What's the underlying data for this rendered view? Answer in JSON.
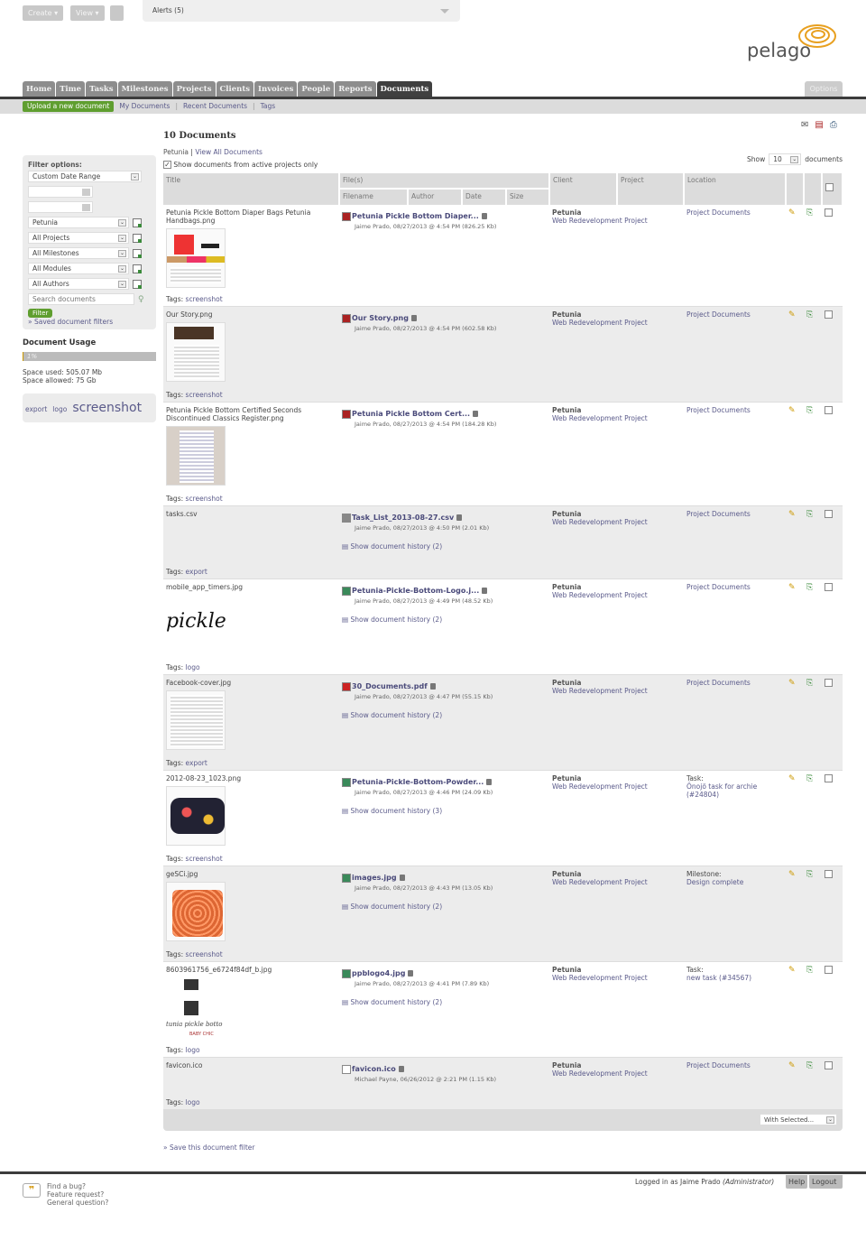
{
  "topbar": {
    "create": "Create ▾",
    "view": "View ▾",
    "alerts": "Alerts (5)"
  },
  "brand": {
    "name": "pelago",
    "accent": "#e8a020"
  },
  "nav": {
    "tabs": [
      "Home",
      "Time",
      "Tasks",
      "Milestones",
      "Projects",
      "Clients",
      "Invoices",
      "People",
      "Reports",
      "Documents"
    ],
    "active": "Documents",
    "options": "Options"
  },
  "subnav": {
    "upload": "Upload a new document",
    "links": [
      "My Documents",
      "Recent Documents",
      "Tags"
    ]
  },
  "filters": {
    "heading": "Filter options:",
    "date_range": "Custom Date Range",
    "client": "Petunia",
    "project": "All Projects",
    "milestone": "All Milestones",
    "module": "All Modules",
    "author": "All Authors",
    "search_placeholder": "Search documents",
    "filter_button": "Filter",
    "saved": "» Saved document filters"
  },
  "usage": {
    "title": "Document Usage",
    "percent": "1%",
    "percent_value": 1,
    "used": "Space used: 505.07 Mb",
    "allowed": "Space allowed: 75 Gb"
  },
  "tagcloud": [
    "export",
    "logo",
    "screenshot"
  ],
  "main": {
    "title": "10 Documents",
    "crumb_client": "Petunia",
    "crumb_sep": "|",
    "view_all": "View All Documents",
    "active_only": "Show documents from active projects only",
    "show_label": "Show",
    "show_value": "10",
    "show_suffix": "documents",
    "save_filter": "» Save this document filter",
    "with_selected": "With Selected..."
  },
  "columns": {
    "title": "Title",
    "files": "File(s)",
    "filename": "Filename",
    "author": "Author",
    "date": "Date",
    "size": "Size",
    "client": "Client",
    "project": "Project",
    "location": "Location"
  },
  "documents": [
    {
      "title": "Petunia Pickle Bottom Diaper Bags Petunia Handbags.png",
      "file": "Petunia Pickle Bottom Diaper...",
      "type": "png",
      "meta": "Jaime Prado, 08/27/2013 @ 4:54 PM (826.25 Kb)",
      "history": "",
      "client": "Petunia",
      "project": "Web Redevelopment Project",
      "loc1": "Project Documents",
      "loc2": "",
      "tags_label": "Tags:",
      "tags": "screenshot"
    },
    {
      "title": "Our Story.png",
      "file": "Our Story.png",
      "type": "png",
      "meta": "Jaime Prado, 08/27/2013 @ 4:54 PM (602.58 Kb)",
      "history": "",
      "client": "Petunia",
      "project": "Web Redevelopment Project",
      "loc1": "Project Documents",
      "loc2": "",
      "tags_label": "Tags:",
      "tags": "screenshot"
    },
    {
      "title": "Petunia Pickle Bottom Certified Seconds Discontinued Classics Register.png",
      "file": "Petunia Pickle Bottom Cert...",
      "type": "png",
      "meta": "Jaime Prado, 08/27/2013 @ 4:54 PM (184.28 Kb)",
      "history": "",
      "client": "Petunia",
      "project": "Web Redevelopment Project",
      "loc1": "Project Documents",
      "loc2": "",
      "tags_label": "Tags:",
      "tags": "screenshot"
    },
    {
      "title": "tasks.csv",
      "file": "Task_List_2013-08-27.csv",
      "type": "csv",
      "meta": "Jaime Prado, 08/27/2013 @ 4:50 PM (2.01 Kb)",
      "history": "Show document history (2)",
      "client": "Petunia",
      "project": "Web Redevelopment Project",
      "loc1": "Project Documents",
      "loc2": "",
      "tags_label": "Tags:",
      "tags": "export"
    },
    {
      "title": "mobile_app_timers.jpg",
      "file": "Petunia-Pickle-Bottom-Logo.j...",
      "type": "img",
      "meta": "Jaime Prado, 08/27/2013 @ 4:49 PM (48.52 Kb)",
      "history": "Show document history (2)",
      "client": "Petunia",
      "project": "Web Redevelopment Project",
      "loc1": "Project Documents",
      "loc2": "",
      "tags_label": "Tags:",
      "tags": "logo"
    },
    {
      "title": "Facebook-cover.jpg",
      "file": "30_Documents.pdf",
      "type": "pdf",
      "meta": "Jaime Prado, 08/27/2013 @ 4:47 PM (55.15 Kb)",
      "history": "Show document history (2)",
      "client": "Petunia",
      "project": "Web Redevelopment Project",
      "loc1": "Project Documents",
      "loc2": "",
      "tags_label": "Tags:",
      "tags": "export"
    },
    {
      "title": "2012-08-23_1023.png",
      "file": "Petunia-Pickle-Bottom-Powder...",
      "type": "img",
      "meta": "Jaime Prado, 08/27/2013 @ 4:46 PM (24.09 Kb)",
      "history": "Show document history (3)",
      "client": "Petunia",
      "project": "Web Redevelopment Project",
      "loc1": "Task:",
      "loc2": "Önojö task for archie (#24804)",
      "tags_label": "Tags:",
      "tags": "screenshot"
    },
    {
      "title": "geSCi.jpg",
      "file": "images.jpg",
      "type": "img",
      "meta": "Jaime Prado, 08/27/2013 @ 4:43 PM (13.05 Kb)",
      "history": "Show document history (2)",
      "client": "Petunia",
      "project": "Web Redevelopment Project",
      "loc1": "Milestone:",
      "loc2": "Design complete",
      "tags_label": "Tags:",
      "tags": "screenshot"
    },
    {
      "title": "8603961756_e6724f84df_b.jpg",
      "file": "ppblogo4.jpg",
      "type": "img",
      "meta": "Jaime Prado, 08/27/2013 @ 4:41 PM (7.89 Kb)",
      "history": "Show document history (2)",
      "client": "Petunia",
      "project": "Web Redevelopment Project",
      "loc1": "Task:",
      "loc2": "new task (#34567)",
      "tags_label": "Tags:",
      "tags": "logo"
    },
    {
      "title": "favicon.ico",
      "file": "favicon.ico",
      "type": "blank",
      "meta": "Michael Payne, 06/26/2012 @ 2:21 PM (1.15 Kb)",
      "history": "",
      "client": "Petunia",
      "project": "Web Redevelopment Project",
      "loc1": "Project Documents",
      "loc2": "",
      "tags_label": "Tags:",
      "tags": "logo"
    }
  ],
  "thumb_text": {
    "logo": "pickle",
    "ppb": "tunia pickle botto",
    "ppb_sub": "BABY CHIC"
  },
  "footer": {
    "bug": "Find a bug?",
    "feature": "Feature request?",
    "question": "General question?",
    "logged_in": "Logged in as Jaime Prado",
    "role": "(Administrator)",
    "help": "Help",
    "logout": "Logout"
  }
}
